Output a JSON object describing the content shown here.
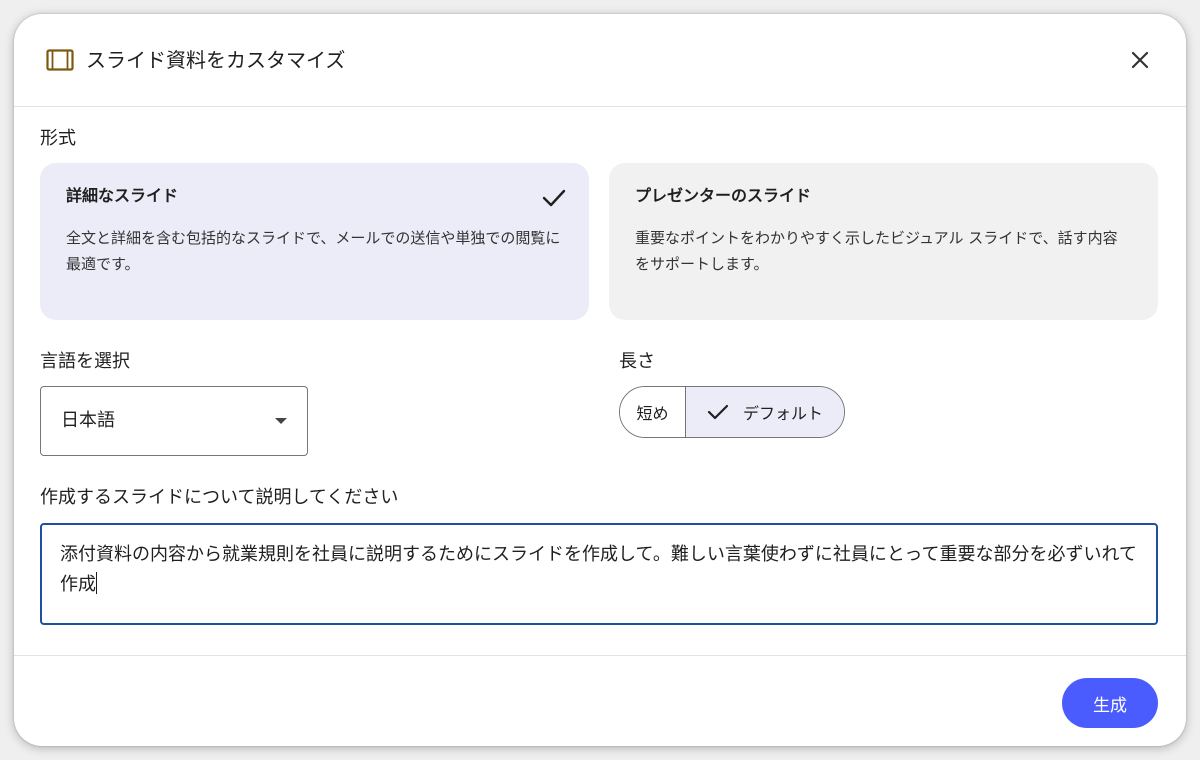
{
  "dialog": {
    "title": "スライド資料をカスタマイズ",
    "icons": {
      "title_icon": "slides-icon",
      "close_icon": "close-icon"
    }
  },
  "format": {
    "label": "形式",
    "options": [
      {
        "title": "詳細なスライド",
        "description": "全文と詳細を含む包括的なスライドで、メールでの送信や単独での閲覧に最適です。",
        "selected": true
      },
      {
        "title": "プレゼンターのスライド",
        "description": "重要なポイントをわかりやすく示したビジュアル スライドで、話す内容をサポートします。",
        "selected": false
      }
    ]
  },
  "language": {
    "label": "言語を選択",
    "value": "日本語"
  },
  "length": {
    "label": "長さ",
    "options": [
      {
        "label": "短め",
        "selected": false
      },
      {
        "label": "デフォルト",
        "selected": true
      }
    ]
  },
  "description": {
    "label": "作成するスライドについて説明してください",
    "value": "添付資料の内容から就業規則を社員に説明するためにスライドを作成して。難しい言葉使わずに社員にとって重要な部分を必ずいれて作成"
  },
  "footer": {
    "generate_label": "生成"
  },
  "colors": {
    "accent": "#4b5cff",
    "selected_bg": "#ebecf8",
    "focus_border": "#1f4fa0"
  }
}
